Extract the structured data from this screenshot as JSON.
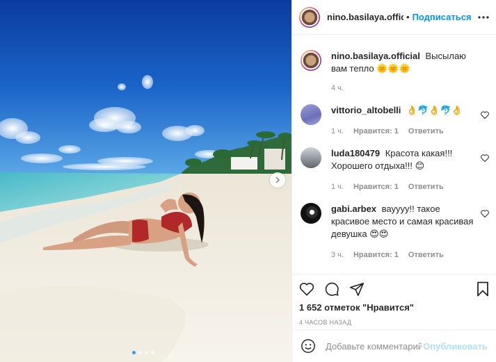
{
  "post": {
    "username": "nino.basilaya.official",
    "separator": "•",
    "follow_label": "Подписаться",
    "more_icon": "more-horizontal-icon",
    "caption": {
      "username": "nino.basilaya.official",
      "text": "Высылаю вам тепло",
      "emoji": "🌞🌞🌞",
      "time": "4 ч."
    },
    "comments": [
      {
        "username": "vittorio_altobelli",
        "text": "",
        "emoji": "👌🐬👌🐬👌",
        "time": "1 ч.",
        "likes": "Нравится: 1",
        "reply": "Ответить"
      },
      {
        "username": "luda180479",
        "text": "Красота какая!!! Хорошего отдыха!!!",
        "emoji": "😊",
        "time": "1 ч.",
        "likes": "Нравится: 1",
        "reply": "Ответить"
      },
      {
        "username": "gabi.arbex",
        "text": "вауууу!! такое красивое место и самая красивая девушка",
        "emoji": "😍😍",
        "time": "3 ч.",
        "likes": "Нравится: 1",
        "reply": "Ответить"
      }
    ],
    "likes_text": "1 652 отметок \"Нравится\"",
    "time_ago": "4 ЧАСОВ НАЗАД",
    "add_comment": {
      "placeholder": "Добавьте комментарий...",
      "publish_label": "Опубликовать"
    },
    "carousel": {
      "total_slides": 4,
      "active_slide": 1
    },
    "colors": {
      "accent": "#0095f6",
      "publish_disabled": "#b2dffc",
      "muted": "#8e8e8e",
      "text": "#262626"
    }
  }
}
